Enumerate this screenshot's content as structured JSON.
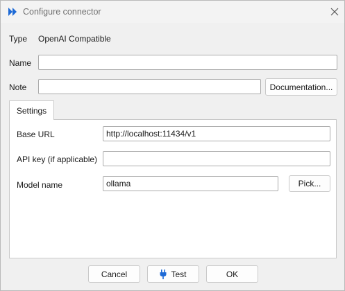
{
  "window": {
    "title": "Configure connector",
    "accent_color": "#1e6ad6"
  },
  "form": {
    "type_label": "Type",
    "type_value": "OpenAI Compatible",
    "name_label": "Name",
    "name_value": "",
    "note_label": "Note",
    "note_value": "",
    "documentation_button": "Documentation..."
  },
  "tabs": [
    {
      "label": "Settings",
      "selected": true
    }
  ],
  "settings": {
    "base_url_label": "Base URL",
    "base_url_value": "http://localhost:11434/v1",
    "api_key_label": "API key (if applicable)",
    "api_key_value": "",
    "model_name_label": "Model name",
    "model_name_value": "ollama",
    "pick_button": "Pick..."
  },
  "footer": {
    "cancel_label": "Cancel",
    "test_label": "Test",
    "ok_label": "OK"
  },
  "icons": {
    "app": "app-logo-icon",
    "close": "close-icon",
    "test": "plug-icon"
  }
}
